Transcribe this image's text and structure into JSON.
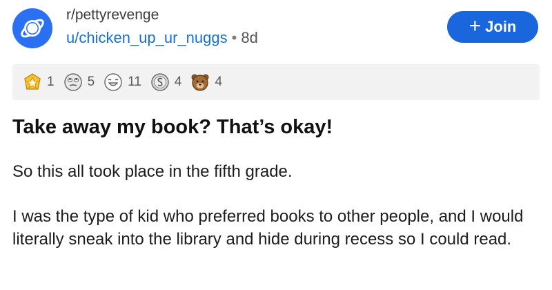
{
  "post": {
    "subreddit": "r/pettyrevenge",
    "username": "u/chicken_up_ur_nuggs",
    "separator": "•",
    "age": "8d",
    "join_label": "Join",
    "join_plus": "+",
    "title": "Take away my book? That’s okay!",
    "paragraphs": [
      "So this all took place in the fifth grade.",
      "I was the type of kid who preferred books to other people, and I would literally sneak into the library and hide during recess so I could read."
    ]
  },
  "awards": [
    {
      "icon": "star-award-icon",
      "count": "1",
      "color": "#e8b21a"
    },
    {
      "icon": "eye-roll-award-icon",
      "count": "5",
      "color": "#9a9a9a"
    },
    {
      "icon": "laughing-face-award-icon",
      "count": "11",
      "color": "#8a8a8a"
    },
    {
      "icon": "silver-coin-award-icon",
      "count": "4",
      "color": "#7d7d7d"
    },
    {
      "icon": "bear-award-icon",
      "count": "4",
      "color": "#8b5a2b"
    }
  ],
  "colors": {
    "accent": "#1a66dc",
    "subreddit_icon_bg": "#2b6ff2",
    "username": "#1570d6",
    "awards_bar_bg": "#f2f2f3"
  }
}
